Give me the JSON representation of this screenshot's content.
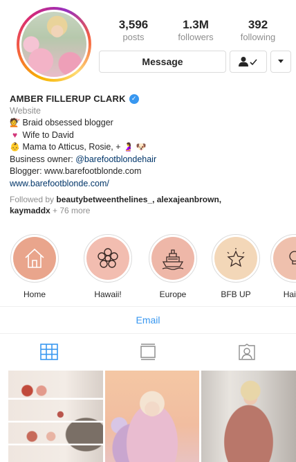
{
  "profile": {
    "posts_count": "3,596",
    "posts_label": "posts",
    "followers_count": "1.3M",
    "followers_label": "followers",
    "following_count": "392",
    "following_label": "following",
    "message_label": "Message",
    "follow_status_icon": "person-check-icon",
    "more_icon": "caret-down-icon"
  },
  "bio": {
    "name": "AMBER FILLERUP CLARK",
    "category": "Website",
    "line1": "Braid obsessed blogger",
    "line2": "Wife to David",
    "line3": "Mama to Atticus, Rosie, +",
    "line4_prefix": "Business owner: ",
    "line4_handle": "@barefootblondehair",
    "line5": "Blogger: www.barefootblonde.com",
    "website": "www.barefootblonde.com/",
    "followed_prefix": "Followed by ",
    "followed_names": "beautybetweenthelines_, alexajeanbrown,",
    "followed_names2": "kaymaddx",
    "followed_more": " + 76 more"
  },
  "highlights": [
    {
      "label": "Home",
      "icon": "house-icon",
      "color": "#e9a58c"
    },
    {
      "label": "Hawaii!",
      "icon": "flower-icon",
      "color": "#f2bdb0"
    },
    {
      "label": "Europe",
      "icon": "ship-icon",
      "color": "#eeb7a8"
    },
    {
      "label": "BFB UP",
      "icon": "star-icon",
      "color": "#f3d7b8"
    },
    {
      "label": "Hair T",
      "icon": "lightbulb-icon",
      "color": "#efc0ad"
    }
  ],
  "contact": {
    "email_label": "Email"
  },
  "tabs": [
    {
      "name": "grid",
      "icon": "grid-icon",
      "active": true
    },
    {
      "name": "feed",
      "icon": "feed-icon",
      "active": false
    },
    {
      "name": "tagged",
      "icon": "tagged-person-icon",
      "active": false
    }
  ],
  "colors": {
    "accent": "#3897f0",
    "muted": "#8e8e8e",
    "text": "#262626"
  }
}
